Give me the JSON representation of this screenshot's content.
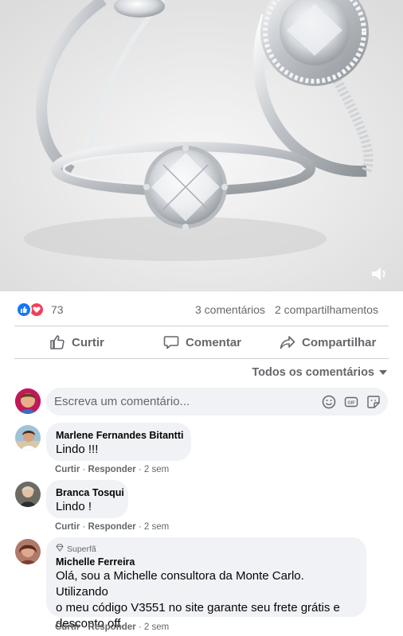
{
  "post": {
    "reaction_count": "73",
    "comments_count": "3 comentários",
    "shares_count": "2 compartilhamentos",
    "reactions": [
      "like-icon",
      "love-icon"
    ]
  },
  "actions": {
    "like_label": "Curtir",
    "comment_label": "Comentar",
    "share_label": "Compartilhar"
  },
  "sort": {
    "label": "Todos os comentários"
  },
  "composer": {
    "placeholder": "Escreva um comentário...",
    "icons": [
      "emoji-icon",
      "gif-icon",
      "sticker-icon"
    ]
  },
  "comments": [
    {
      "name": "Marlene Fernandes Bitantti",
      "text": "Lindo !!!",
      "like": "Curtir",
      "reply": "Responder",
      "time": "2 sem"
    },
    {
      "name": "Branca Tosqui",
      "text": "Lindo !",
      "like": "Curtir",
      "reply": "Responder",
      "time": "2 sem"
    },
    {
      "badge": "Superfã",
      "name": "Michelle Ferreira",
      "text_lines": [
        "Olá, sou a Michelle consultora da Monte Carlo. Utilizando",
        "o meu código V3551 no site garante seu frete grátis e",
        "desconto off."
      ],
      "like": "Curtir",
      "reply": "Responder",
      "time": "2 sem"
    }
  ],
  "colors": {
    "like_blue": "#1877f2",
    "love_red": "#f33e58",
    "secondary_text": "#65676b",
    "bubble_bg": "#f0f2f5"
  }
}
